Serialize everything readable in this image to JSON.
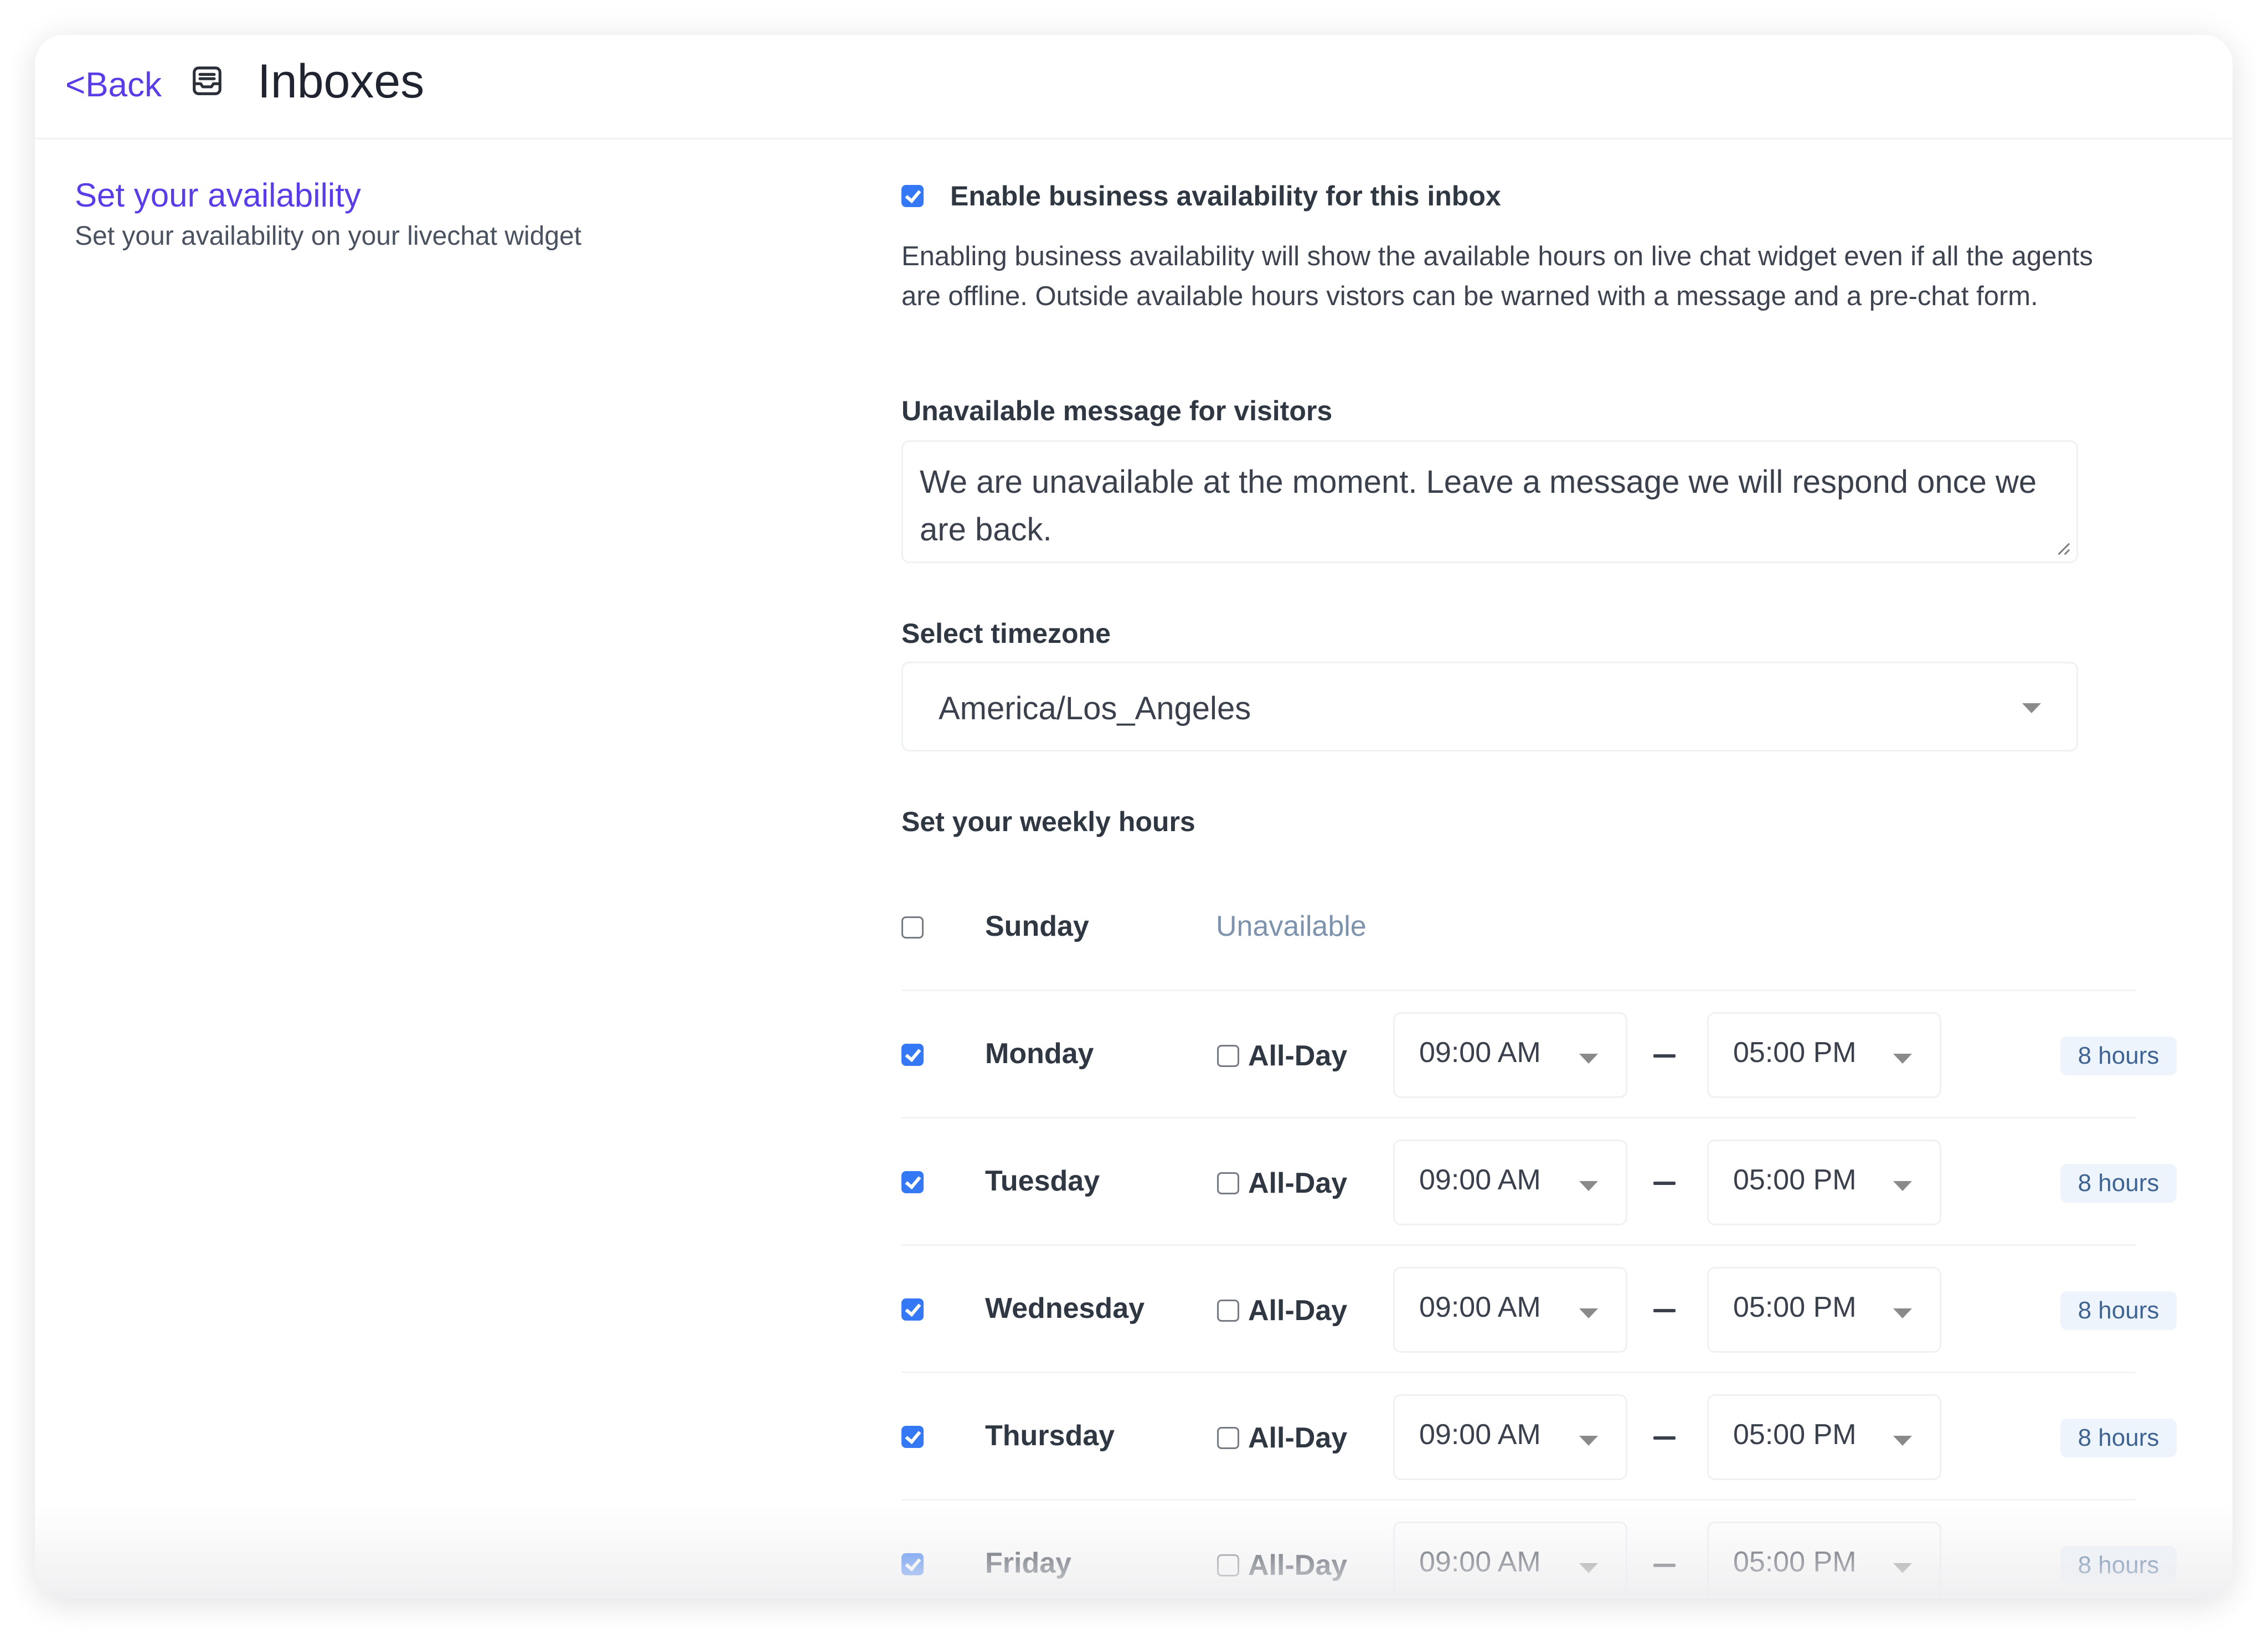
{
  "header": {
    "back_label": "<Back",
    "icon": "inbox-tray-icon",
    "title": "Inboxes"
  },
  "section": {
    "title": "Set your availability",
    "subtitle": "Set your availability on your livechat widget"
  },
  "availability": {
    "enable_label": "Enable business availability for this inbox",
    "enabled": true,
    "description": "Enabling business availability will show the available hours on live chat widget even if all the agents are offline. Outside available hours vistors can be warned with a message and a pre-chat form.",
    "message_label": "Unavailable message for visitors",
    "message_value": "We are unavailable at the moment. Leave a message we will respond once we are back.",
    "timezone_label": "Select timezone",
    "timezone_value": "America/Los_Angeles",
    "weekly_label": "Set your weekly hours"
  },
  "all_day_label": "All-Day",
  "unavailable_label": "Unavailable",
  "days": [
    {
      "name": "Sunday",
      "enabled": false,
      "status": "Unavailable"
    },
    {
      "name": "Monday",
      "enabled": true,
      "all_day": false,
      "start": "09:00 AM",
      "end": "05:00 PM",
      "duration": "8 hours"
    },
    {
      "name": "Tuesday",
      "enabled": true,
      "all_day": false,
      "start": "09:00 AM",
      "end": "05:00 PM",
      "duration": "8 hours"
    },
    {
      "name": "Wednesday",
      "enabled": true,
      "all_day": false,
      "start": "09:00 AM",
      "end": "05:00 PM",
      "duration": "8 hours"
    },
    {
      "name": "Thursday",
      "enabled": true,
      "all_day": false,
      "start": "09:00 AM",
      "end": "05:00 PM",
      "duration": "8 hours"
    },
    {
      "name": "Friday",
      "enabled": true,
      "all_day": false,
      "start": "09:00 AM",
      "end": "05:00 PM",
      "duration": "8 hours"
    }
  ],
  "colors": {
    "accent": "#5b3de8",
    "checkbox": "#3478f6",
    "badge_bg": "#edf4fc",
    "badge_text": "#3f6491",
    "muted": "#7d93ad"
  }
}
